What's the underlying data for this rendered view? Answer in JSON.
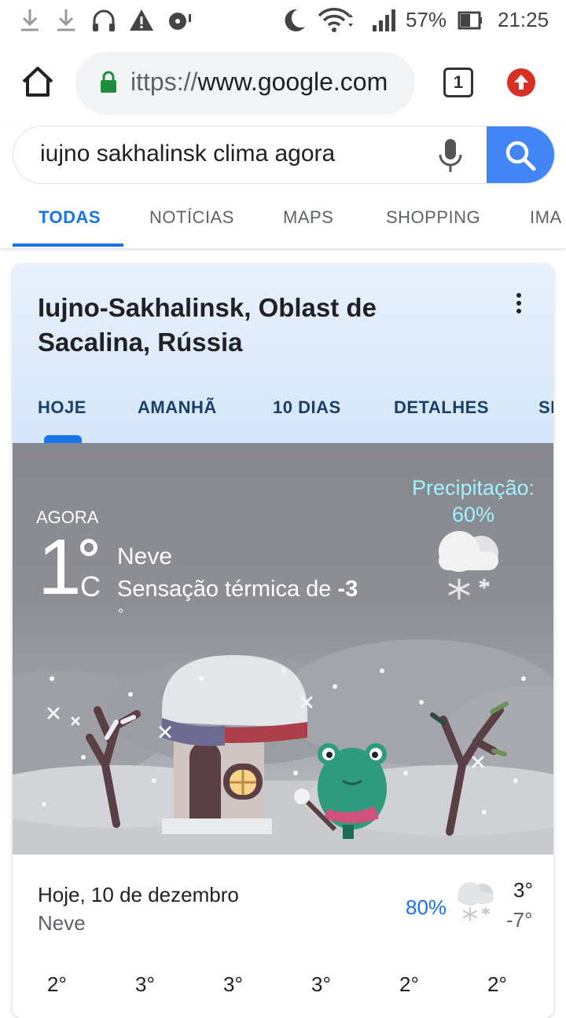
{
  "status_bar": {
    "icons": [
      "download-icon",
      "download-icon",
      "headset-icon",
      "warning-icon",
      "media-icon",
      "moon-icon",
      "wifi-icon",
      "signal-icon",
      "battery-icon"
    ],
    "battery": "57%",
    "time": "21:25"
  },
  "browser": {
    "url_scheme": "ittps://",
    "url_host": "www.google.com",
    "tab_count": "1"
  },
  "search": {
    "query": "iujno sakhalinsk clima agora",
    "tabs": [
      {
        "label": "TODAS",
        "active": true
      },
      {
        "label": "NOTÍCIAS",
        "active": false
      },
      {
        "label": "MAPS",
        "active": false
      },
      {
        "label": "SHOPPING",
        "active": false
      },
      {
        "label": "IMA",
        "active": false
      }
    ]
  },
  "weather": {
    "location": "Iujno-Sakhalinsk, Oblast de Sacalina, Rússia",
    "tabs": [
      "HOJE",
      "AMANHÃ",
      "10 DIAS",
      "DETALHES",
      "SI"
    ],
    "now_label": "AGORA",
    "temperature": "1",
    "unit": "C",
    "condition": "Neve",
    "feels_like_prefix": "Sensação térmica de",
    "feels_like_value": "-3",
    "feels_like_unit": "°",
    "precip_label": "Precipitação:",
    "precip_value": "60%",
    "today": {
      "title": "Hoje, 10 de dezembro",
      "condition": "Neve",
      "precip": "80%",
      "high": "3°",
      "low": "-7°",
      "hourly": [
        "2°",
        "3°",
        "3°",
        "3°",
        "2°",
        "2°"
      ]
    }
  },
  "colors": {
    "accent": "#1a73e8",
    "search_button": "#4285f4",
    "precip_text": "#9ff3ff",
    "lock": "#1e8e3e",
    "update": "#d93025"
  }
}
